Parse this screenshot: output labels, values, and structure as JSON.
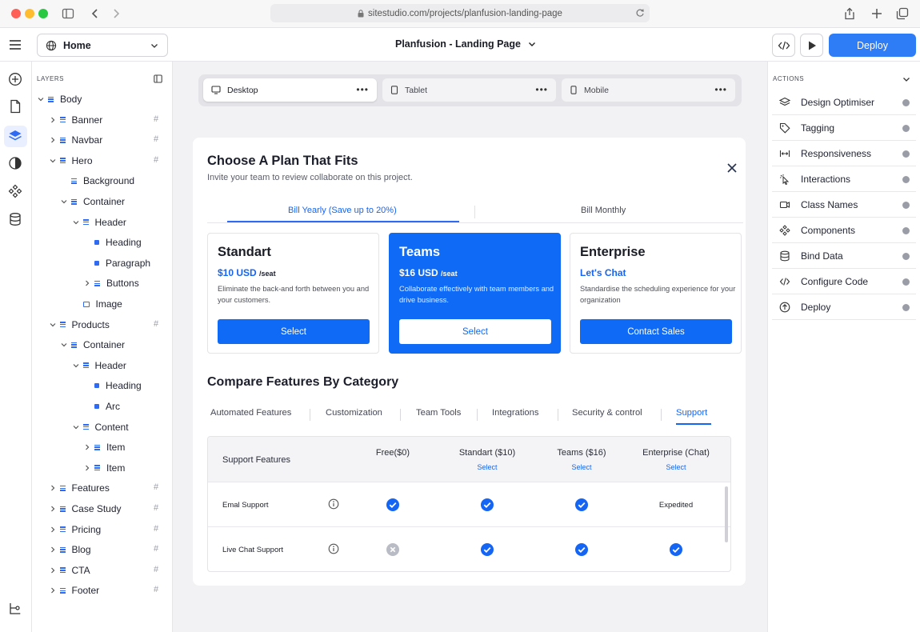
{
  "browser": {
    "url": "sitestudio.com/projects/planfusion-landing-page"
  },
  "toolbar": {
    "page_select": "Home",
    "project_title": "Planfusion - Landing Page",
    "deploy_label": "Deploy"
  },
  "layers": {
    "header": "LAYERS",
    "items": [
      {
        "label": "Body",
        "icon": "bars",
        "expanded": true,
        "hash": false
      },
      {
        "label": "Banner",
        "icon": "bars",
        "expanded": false,
        "hash": true
      },
      {
        "label": "Navbar",
        "icon": "bars",
        "expanded": false,
        "hash": true
      },
      {
        "label": "Hero",
        "icon": "bars",
        "expanded": true,
        "hash": true
      },
      {
        "label": "Background",
        "icon": "bars",
        "expanded": null,
        "hash": false
      },
      {
        "label": "Container",
        "icon": "bars",
        "expanded": true,
        "hash": false
      },
      {
        "label": "Header",
        "icon": "bars",
        "expanded": true,
        "hash": false
      },
      {
        "label": "Heading",
        "icon": "dot",
        "expanded": null,
        "hash": false
      },
      {
        "label": "Paragraph",
        "icon": "dot",
        "expanded": null,
        "hash": false
      },
      {
        "label": "Buttons",
        "icon": "bars",
        "expanded": false,
        "hash": false
      },
      {
        "label": "Image",
        "icon": "image",
        "expanded": null,
        "hash": false
      },
      {
        "label": "Products",
        "icon": "bars",
        "expanded": true,
        "hash": true
      },
      {
        "label": "Container",
        "icon": "bars",
        "expanded": true,
        "hash": false
      },
      {
        "label": "Header",
        "icon": "bars",
        "expanded": true,
        "hash": false
      },
      {
        "label": "Heading",
        "icon": "dot",
        "expanded": null,
        "hash": false
      },
      {
        "label": "Arc",
        "icon": "dot",
        "expanded": null,
        "hash": false
      },
      {
        "label": "Content",
        "icon": "bars",
        "expanded": true,
        "hash": false
      },
      {
        "label": "Item",
        "icon": "bars",
        "expanded": false,
        "hash": false
      },
      {
        "label": "Item",
        "icon": "bars",
        "expanded": false,
        "hash": false
      },
      {
        "label": "Features",
        "icon": "bars",
        "expanded": false,
        "hash": true
      },
      {
        "label": "Case Study",
        "icon": "bars",
        "expanded": false,
        "hash": true
      },
      {
        "label": "Pricing",
        "icon": "bars",
        "expanded": false,
        "hash": true
      },
      {
        "label": "Blog",
        "icon": "bars",
        "expanded": false,
        "hash": true
      },
      {
        "label": "CTA",
        "icon": "bars",
        "expanded": false,
        "hash": true
      },
      {
        "label": "Footer",
        "icon": "bars",
        "expanded": false,
        "hash": true
      }
    ],
    "hash_symbol": "#"
  },
  "devices": {
    "desktop": "Desktop",
    "tablet": "Tablet",
    "mobile": "Mobile",
    "more": "•••"
  },
  "modal": {
    "title": "Choose A Plan That Fits",
    "subtitle": "Invite your team to review collaborate on this project.",
    "billing": {
      "yearly": "Bill Yearly (Save up to 20%)",
      "monthly": "Bill Monthly"
    },
    "plans": [
      {
        "name": "Standart",
        "price": "$10 USD",
        "unit": "/seat",
        "desc": "Eliminate the back-and forth between you and your customers.",
        "button": "Select"
      },
      {
        "name": "Teams",
        "price": "$16 USD",
        "unit": "/seat",
        "desc": "Collaborate effectively with team members and drive business.",
        "button": "Select"
      },
      {
        "name": "Enterprise",
        "price": "Let's Chat",
        "unit": "",
        "desc": "Standardise the scheduling experience for your organization",
        "button": "Contact Sales"
      }
    ],
    "compare_title": "Compare Features By Category",
    "categories": [
      "Automated Features",
      "Customization",
      "Team Tools",
      "Integrations",
      "Security & control",
      "Support"
    ],
    "table": {
      "header_label": "Support Features",
      "columns": [
        {
          "label": "Free($0)",
          "sub": ""
        },
        {
          "label": "Standart ($10)",
          "sub": "Select"
        },
        {
          "label": "Teams ($16)",
          "sub": "Select"
        },
        {
          "label": "Enterprise (Chat)",
          "sub": "Select"
        }
      ],
      "rows": [
        {
          "name": "Emal Support",
          "values": [
            "check",
            "check",
            "check",
            "Expedited"
          ]
        },
        {
          "name": "Live Chat Support",
          "values": [
            "cross",
            "check",
            "check",
            "check"
          ]
        }
      ]
    }
  },
  "actions": {
    "header": "ACTIONS",
    "items": [
      {
        "label": "Design Optimiser",
        "icon": "layers-icon"
      },
      {
        "label": "Tagging",
        "icon": "tag-icon"
      },
      {
        "label": "Responsiveness",
        "icon": "resize-icon"
      },
      {
        "label": "Interactions",
        "icon": "pointer-icon"
      },
      {
        "label": "Class Names",
        "icon": "class-icon"
      },
      {
        "label": "Components",
        "icon": "components-icon"
      },
      {
        "label": "Bind Data",
        "icon": "database-icon"
      },
      {
        "label": "Configure Code",
        "icon": "code-icon"
      },
      {
        "label": "Deploy",
        "icon": "deploy-icon"
      }
    ]
  },
  "colors": {
    "accent": "#2f7df6",
    "plan_selected": "#0f6af5",
    "check": "#1565f5"
  }
}
